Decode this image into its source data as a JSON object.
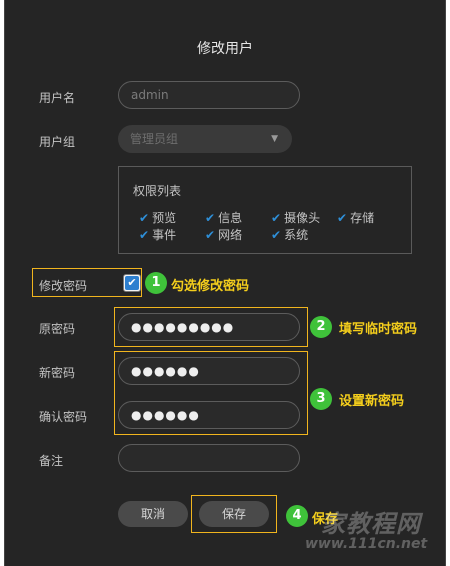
{
  "dialog": {
    "title": "修改用户",
    "username": {
      "label": "用户名",
      "value": "admin"
    },
    "group": {
      "label": "用户组",
      "value": "管理员组"
    },
    "permissions": {
      "title": "权限列表",
      "items": [
        "预览",
        "信息",
        "摄像头",
        "存储",
        "事件",
        "网络",
        "系统"
      ]
    },
    "modify_password": {
      "label": "修改密码",
      "checked": true
    },
    "old_password": {
      "label": "原密码",
      "value": "●●●●●●●●●"
    },
    "new_password": {
      "label": "新密码",
      "value": "●●●●●●"
    },
    "confirm_password": {
      "label": "确认密码",
      "value": "●●●●●●"
    },
    "remark": {
      "label": "备注",
      "value": ""
    },
    "cancel_label": "取消",
    "save_label": "保存"
  },
  "annotations": [
    {
      "number": "1",
      "text": "勾选修改密码"
    },
    {
      "number": "2",
      "text": "填写临时密码"
    },
    {
      "number": "3",
      "text": "设置新密码"
    },
    {
      "number": "4",
      "text": "保存"
    }
  ],
  "watermark": {
    "name": "家教程网",
    "url": "www.111cn.net"
  },
  "colors": {
    "highlight": "#f1b51e",
    "step_badge": "#3fc23a",
    "check": "#2e8fd8",
    "note": "#f4ce1c"
  }
}
